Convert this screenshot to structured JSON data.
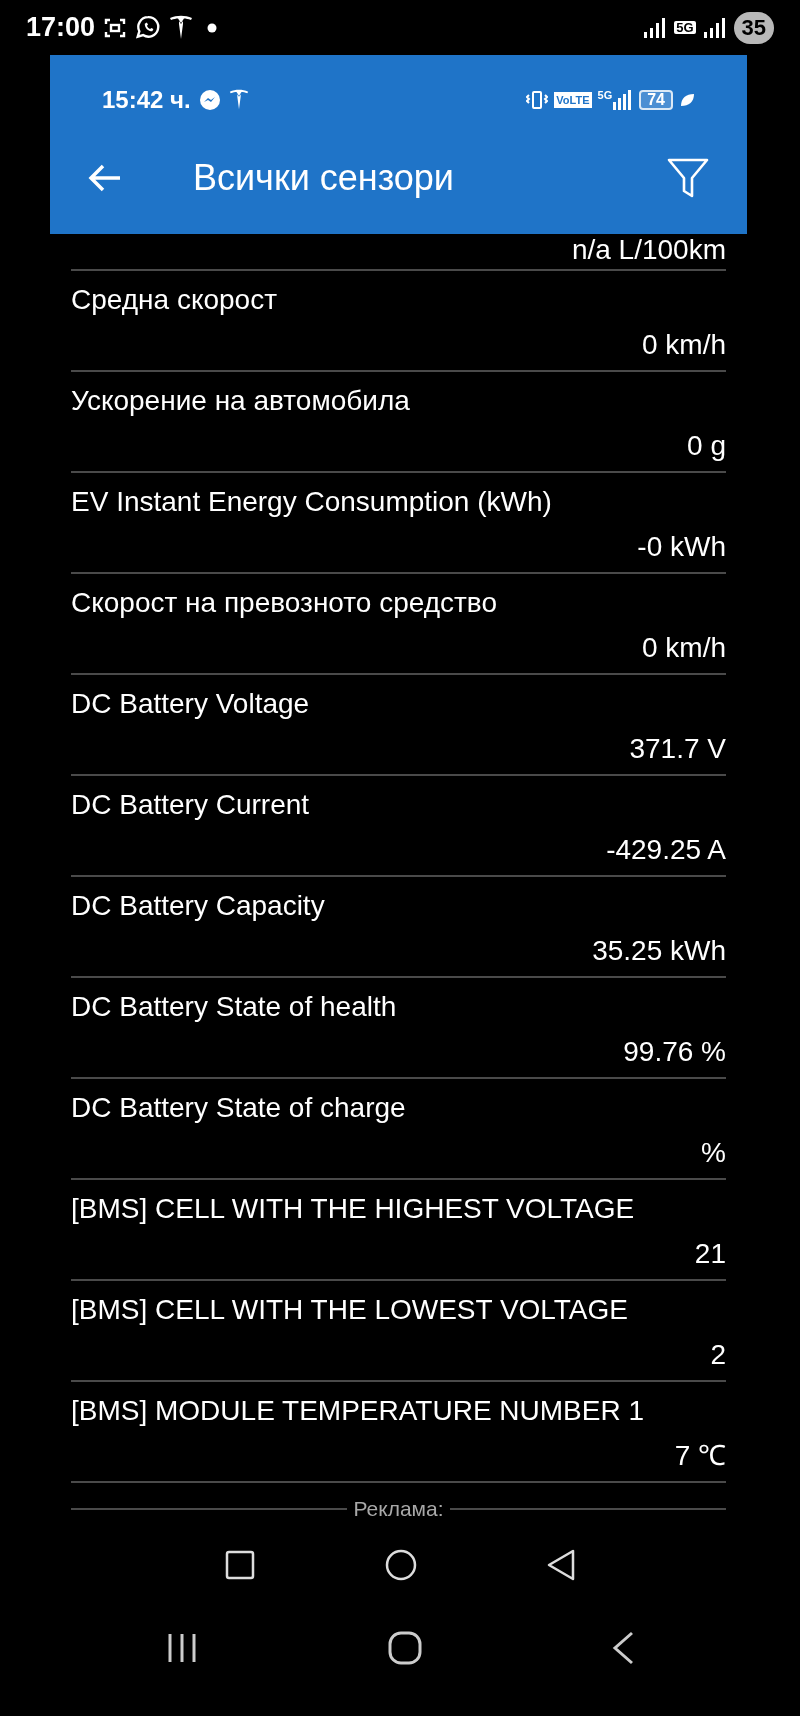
{
  "outer_status_bar": {
    "time": "17:00",
    "network_label": "5G",
    "battery": "35"
  },
  "inner_status_bar": {
    "time": "15:42 ч.",
    "volte": "VoLTE",
    "network_label": "5G",
    "battery": "74"
  },
  "app_bar": {
    "title": "Всички сензори"
  },
  "partial_value": "n/a L/100km",
  "sensors": [
    {
      "name": "Средна скорост",
      "value": "0 km/h"
    },
    {
      "name": "Ускорение на автомобила",
      "value": "0 g"
    },
    {
      "name": "EV Instant Energy Consumption (kWh)",
      "value": "-0 kWh"
    },
    {
      "name": "Скорост на превозното средство",
      "value": "0 km/h"
    },
    {
      "name": "DC Battery Voltage",
      "value": "371.7 V"
    },
    {
      "name": "DC Battery Current",
      "value": "-429.25 A"
    },
    {
      "name": "DC Battery Capacity",
      "value": "35.25 kWh"
    },
    {
      "name": "DC Battery State of health",
      "value": "99.76 %"
    },
    {
      "name": "DC Battery State of charge",
      "value": "%"
    },
    {
      "name": "[BMS] CELL WITH THE HIGHEST VOLTAGE",
      "value": "21"
    },
    {
      "name": "[BMS] CELL WITH THE LOWEST VOLTAGE",
      "value": "2"
    },
    {
      "name": "[BMS] MODULE TEMPERATURE NUMBER 1",
      "value": "7 ℃"
    }
  ],
  "ad_label": "Реклама:"
}
